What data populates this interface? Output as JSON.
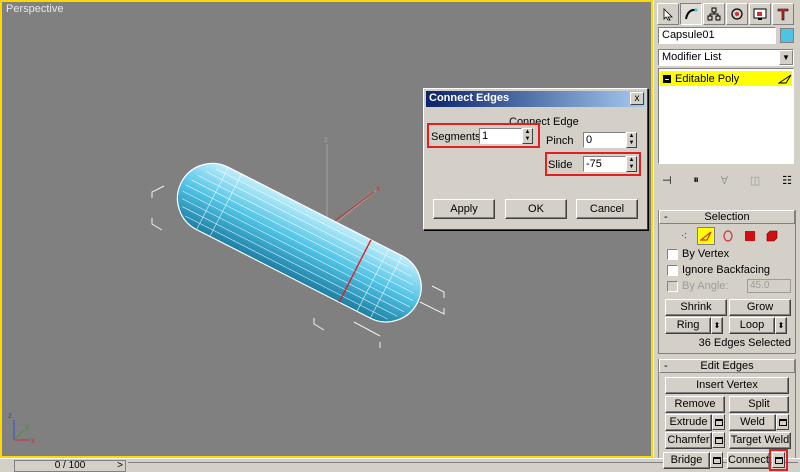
{
  "viewport": {
    "label": "Perspective",
    "border_color": "#ffd800"
  },
  "timeline": {
    "position": "0 / 100",
    "arrow": ">"
  },
  "panel": {
    "object_name": "Capsule01",
    "object_color": "#4fc3e6",
    "modifier_list": "Modifier List",
    "stack_item": "Editable Poly",
    "selection": {
      "title": "Selection",
      "by_vertex": "By Vertex",
      "ignore_backfacing": "Ignore Backfacing",
      "by_angle": "By Angle:",
      "angle_value": "45.0",
      "shrink": "Shrink",
      "grow": "Grow",
      "ring": "Ring",
      "loop": "Loop",
      "status": "36 Edges Selected"
    },
    "edit_edges": {
      "title": "Edit Edges",
      "insert_vertex": "Insert Vertex",
      "remove": "Remove",
      "split": "Split",
      "extrude": "Extrude",
      "weld": "Weld",
      "chamfer": "Chamfer",
      "target_weld": "Target Weld",
      "bridge": "Bridge",
      "connect": "Connect"
    }
  },
  "dialog": {
    "title": "Connect Edges",
    "close": "x",
    "group_label": "Connect Edge",
    "segments_label": "Segments:",
    "segments_value": "1",
    "pinch_label": "Pinch",
    "pinch_value": "0",
    "slide_label": "Slide",
    "slide_value": "-75",
    "apply": "Apply",
    "ok": "OK",
    "cancel": "Cancel"
  }
}
